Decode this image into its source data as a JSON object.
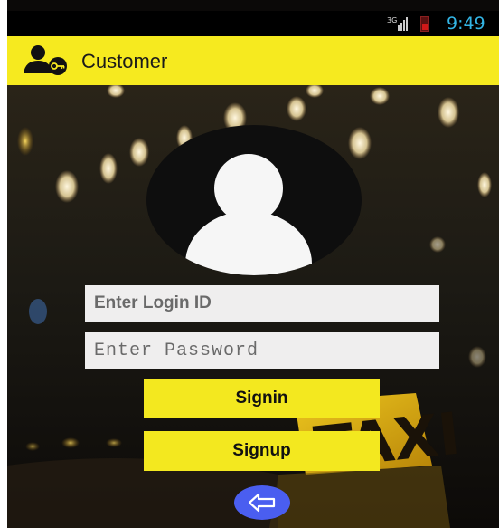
{
  "status_bar": {
    "network_label": "3G",
    "time": "9:49",
    "signal_icon": "signal-bars-icon",
    "battery_icon": "battery-low-icon"
  },
  "action_bar": {
    "title": "Customer",
    "logo_icon": "customer-key-icon",
    "background_color": "#f6ea1f"
  },
  "profile": {
    "avatar_icon": "user-avatar-icon"
  },
  "form": {
    "login_id": {
      "value": "",
      "placeholder": "Enter Login ID"
    },
    "password": {
      "value": "",
      "placeholder": "Enter Password"
    }
  },
  "buttons": {
    "signin_label": "Signin",
    "signup_label": "Signup",
    "back_icon": "arrow-left-icon",
    "button_color": "#f3e81f",
    "back_color": "#4a5ef0"
  },
  "background": {
    "image": "taxi-sign-night-bokeh",
    "sign_text": "TAXI"
  }
}
